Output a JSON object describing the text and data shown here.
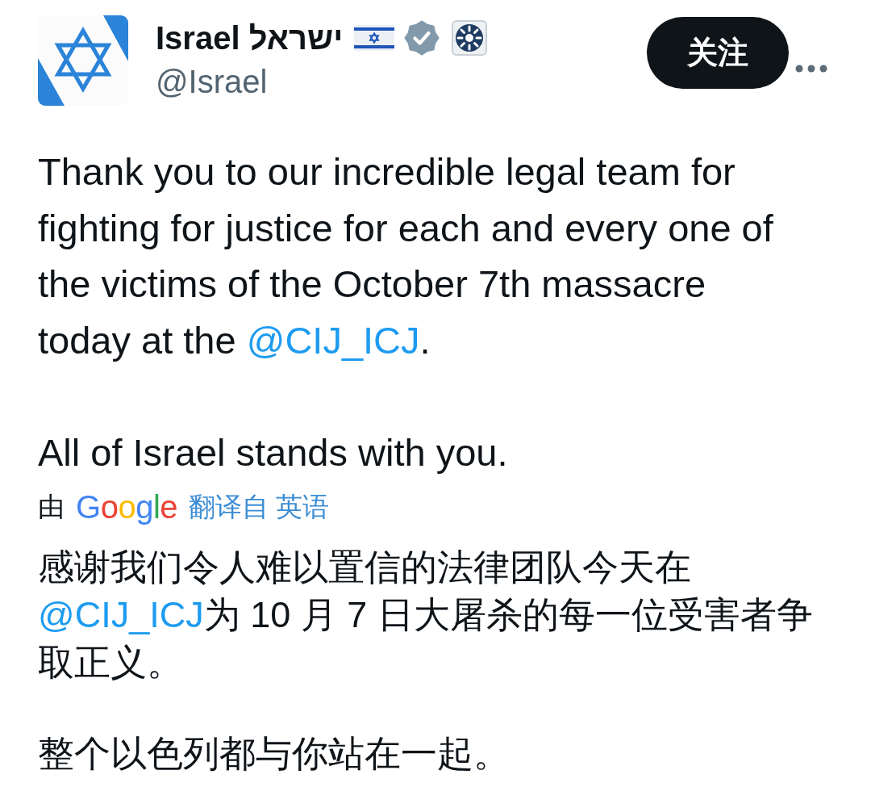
{
  "author": {
    "name": "Israel ישראל",
    "handle": "@Israel",
    "verified": true
  },
  "follow_button": {
    "label": "关注"
  },
  "post": {
    "paragraphs": [
      {
        "segments": [
          {
            "kind": "text",
            "text": "Thank you to our incredible legal team for fighting for justice for each and every one of the victims of the October 7th massacre today at the "
          },
          {
            "kind": "mention",
            "text": "@CIJ_ICJ"
          },
          {
            "kind": "text",
            "text": "."
          }
        ]
      },
      {
        "segments": [
          {
            "kind": "text",
            "text": "All of Israel stands with you."
          }
        ]
      }
    ]
  },
  "translation": {
    "prefix": "由",
    "provider": "Google",
    "source_link": "翻译自 英语",
    "paragraphs": [
      {
        "segments": [
          {
            "kind": "text",
            "text": "感谢我们令人难以置信的法律团队今天在"
          },
          {
            "kind": "mention",
            "text": "@CIJ_ICJ"
          },
          {
            "kind": "text",
            "text": "为 10 月 7 日大屠杀的每一位受害者争取正义。"
          }
        ]
      },
      {
        "segments": [
          {
            "kind": "text",
            "text": "整个以色列都与你站在一起。"
          }
        ]
      }
    ]
  }
}
